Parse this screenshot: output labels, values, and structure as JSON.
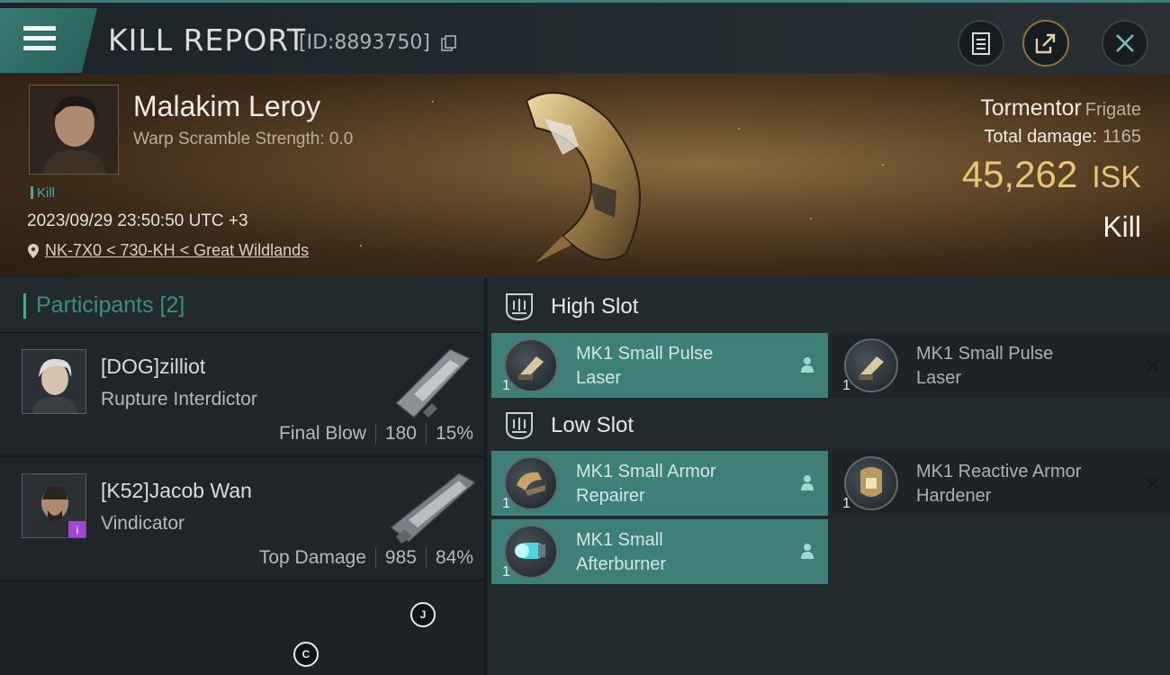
{
  "header": {
    "title": "KILL REPORT",
    "report_id": "[ID:8893750]"
  },
  "victim": {
    "name": "Malakim Leroy",
    "scramble": "Warp Scramble Strength: 0.0",
    "tag": "Kill",
    "datetime": "2023/09/29 23:50:50 UTC +3",
    "location": "NK-7X0 < 730-KH < Great Wildlands",
    "ship": "Tormentor",
    "ship_class": "Frigate",
    "total_damage_label": "Total damage:",
    "total_damage": "1165",
    "isk_value": "45,262",
    "isk_unit": "ISK",
    "result": "Kill"
  },
  "participants": {
    "header": "Participants [2]",
    "items": [
      {
        "name": "[DOG]zilliot",
        "ship": "Rupture Interdictor",
        "role": "Final Blow",
        "damage": "180",
        "percent": "15%"
      },
      {
        "name": "[K52]Jacob Wan",
        "ship": "Vindicator",
        "role": "Top Damage",
        "damage": "985",
        "percent": "84%"
      }
    ]
  },
  "slots": {
    "high": {
      "title": "High Slot",
      "modules": [
        {
          "name_line1": "MK1 Small Pulse",
          "name_line2": "Laser",
          "count": "1",
          "state": "active"
        },
        {
          "name_line1": "MK1 Small Pulse",
          "name_line2": "Laser",
          "count": "1",
          "state": "destroyed"
        }
      ]
    },
    "low": {
      "title": "Low Slot",
      "modules": [
        {
          "name_line1": "MK1 Small Armor",
          "name_line2": "Repairer",
          "count": "1",
          "state": "active"
        },
        {
          "name_line1": "MK1 Reactive Armor",
          "name_line2": "Hardener",
          "count": "1",
          "state": "destroyed"
        },
        {
          "name_line1": "MK1 Small",
          "name_line2": "Afterburner",
          "count": "1",
          "state": "active"
        }
      ]
    }
  },
  "overlay_markers": [
    "J",
    "C"
  ],
  "colors": {
    "accent": "#3e7f78",
    "isk": "#e8c478",
    "badge": "#a046d6"
  },
  "icons": [
    "menu-icon",
    "copy-icon",
    "clipboard-icon",
    "share-icon",
    "close-icon",
    "location-pin-icon",
    "slot-icon",
    "pilot-icon",
    "x-icon"
  ]
}
